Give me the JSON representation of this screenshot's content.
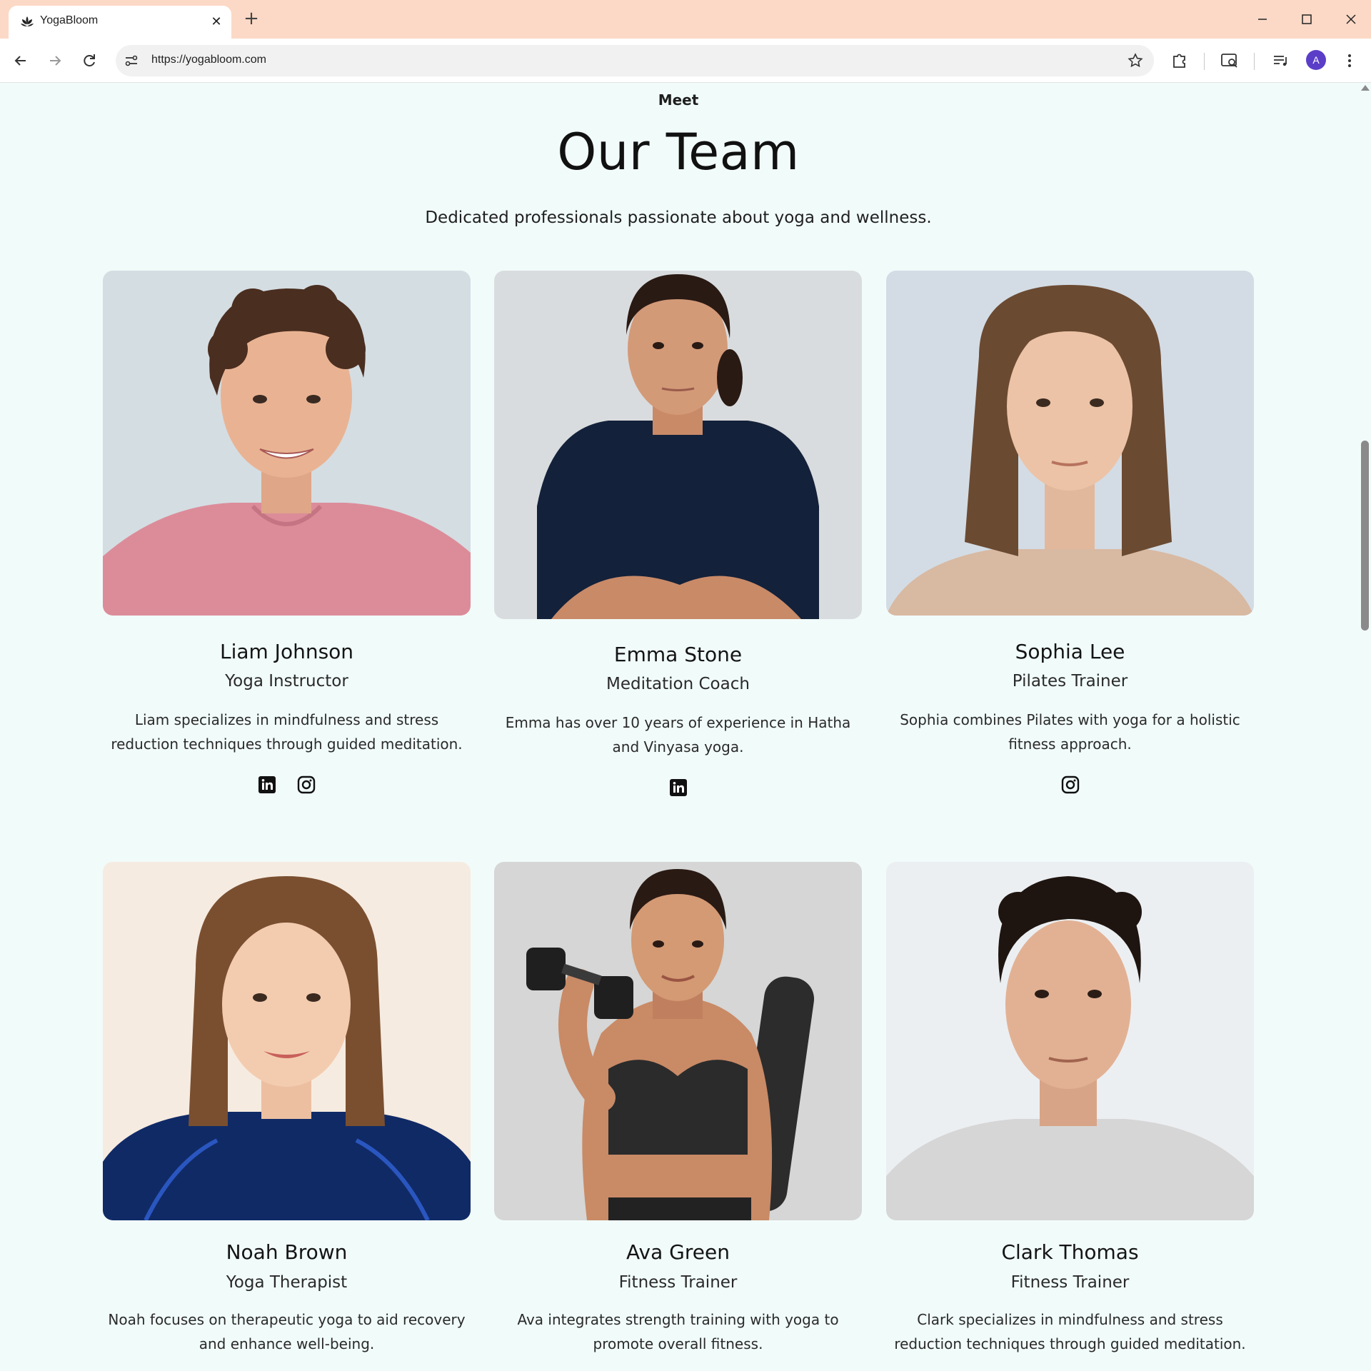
{
  "browser": {
    "tab_title": "YogaBloom",
    "url": "https://yogabloom.com",
    "profile_initial": "A"
  },
  "section": {
    "eyebrow": "Meet",
    "title": "Our Team",
    "subtitle": "Dedicated professionals passionate about yoga and wellness."
  },
  "team": [
    {
      "name": "Liam Johnson",
      "role": "Yoga Instructor",
      "bio": "Liam specializes in mindfulness and stress reduction techniques through guided meditation.",
      "socials": [
        "linkedin",
        "instagram"
      ]
    },
    {
      "name": "Emma Stone",
      "role": "Meditation Coach",
      "bio": "Emma has over 10 years of experience in Hatha and Vinyasa yoga.",
      "socials": [
        "linkedin"
      ]
    },
    {
      "name": "Sophia Lee",
      "role": "Pilates Trainer",
      "bio": "Sophia combines Pilates with yoga for a holistic fitness approach.",
      "socials": [
        "instagram"
      ]
    },
    {
      "name": "Noah Brown",
      "role": "Yoga Therapist",
      "bio": "Noah focuses on therapeutic yoga to aid recovery and enhance well-being.",
      "socials": []
    },
    {
      "name": "Ava Green",
      "role": "Fitness Trainer",
      "bio": "Ava integrates strength training with yoga to promote overall fitness.",
      "socials": []
    },
    {
      "name": "Clark Thomas",
      "role": "Fitness Trainer",
      "bio": "Clark specializes in mindfulness and stress reduction techniques through guided meditation.",
      "socials": []
    }
  ],
  "colors": {
    "page_bg": "#f1fbfa",
    "tabbar_bg": "#fcd9c6",
    "avatar_bg": "#5b3ec8"
  }
}
